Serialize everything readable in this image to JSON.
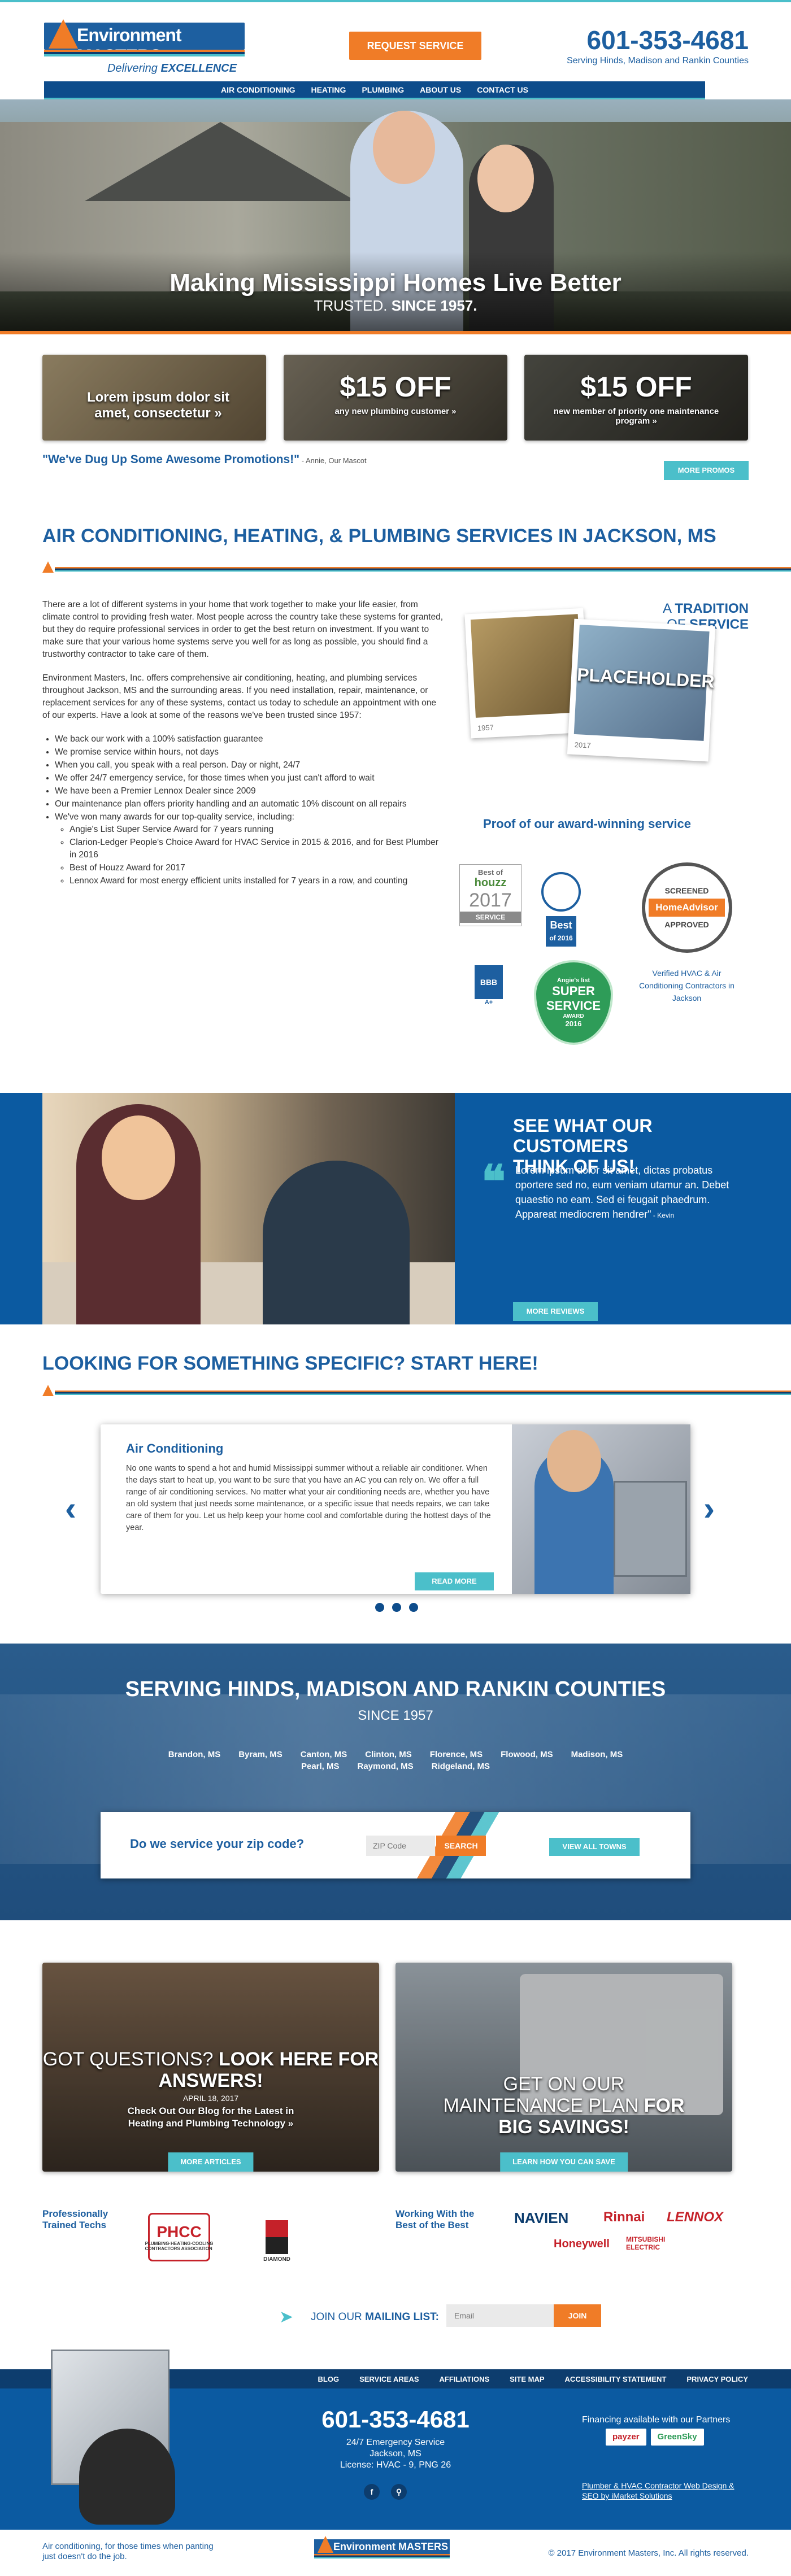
{
  "header": {
    "logo_name": "Environment MASTERS",
    "logo_tag_prefix": "Delivering",
    "logo_tag_bold": "EXCELLENCE",
    "request_button": "REQUEST SERVICE",
    "phone": "601-353-4681",
    "serving": "Serving Hinds, Madison and Rankin Counties"
  },
  "nav": [
    "AIR CONDITIONING",
    "HEATING",
    "PLUMBING",
    "ABOUT US",
    "CONTACT US"
  ],
  "hero": {
    "title": "Making Mississippi Homes Live Better",
    "sub_prefix": "TRUSTED.",
    "sub_bold": "SINCE 1957."
  },
  "promos": {
    "promo1": "Lorem ipsum dolor sit amet, consectetur »",
    "promo2_big": "$15 OFF",
    "promo2_small": "any new plumbing customer »",
    "promo3_big": "$15 OFF",
    "promo3_small": "new member of priority one maintenance program »",
    "quote": "\"We've Dug Up Some Awesome Promotions!\"",
    "quote_by": " - Annie, Our Mascot",
    "more_button": "MORE PROMOS"
  },
  "services": {
    "title_prefix": "AIR CONDITIONING, HEATING, & PLUMBING SERVICES IN",
    "title_bold": "JACKSON, MS",
    "p1": "There are a lot of different systems in your home that work together to make your life easier, from climate control to providing fresh water. Most people across the country take these systems for granted, but they do require professional services in order to get the best return on investment. If you want to make sure that your various home systems serve you well for as long as possible, you should find a trustworthy contractor to take care of them.",
    "p2": "Environment Masters, Inc. offers comprehensive air conditioning, heating, and plumbing services throughout Jackson, MS and the surrounding areas. If you need installation, repair, maintenance, or replacement services for any of these systems, contact us today to schedule an appointment with one of our experts. Have a look at some of the reasons we've been trusted since 1957:",
    "bullets": [
      "We back our work with a 100% satisfaction guarantee",
      "We promise service within hours, not days",
      "When you call, you speak with a real person. Day or night, 24/7",
      "We offer 24/7 emergency service, for those times when you just can't afford to wait",
      "We have been a Premier Lennox Dealer since 2009",
      "Our maintenance plan offers priority handling and an automatic 10% discount on all repairs",
      "We've won many awards for our top-quality service, including:"
    ],
    "sub_bullets": [
      "Angie's List Super Service Award for 7 years running",
      "Clarion-Ledger People's Choice Award for HVAC Service in 2015 & 2016, and for Best Plumber in 2016",
      "Best of Houzz Award for 2017",
      "Lennox Award for most energy efficient units installed for 7 years in a row, and counting"
    ],
    "tradition_prefix": "A",
    "tradition_bold": "TRADITION",
    "tradition_of": "OF",
    "tradition_service": "SERVICE",
    "year_old": "1957",
    "year_new": "2017",
    "placeholder": "PLACEHOLDER",
    "proof": "Proof of our award-winning service",
    "houzz_best_of": "Best of",
    "houzz_name": "houzz",
    "houzz_year": "2017",
    "houzz_service": "SERVICE",
    "clarion_best": "Best",
    "clarion_year": "of 2016",
    "ha_screened": "SCREENED",
    "ha_name": "HomeAdvisor",
    "ha_approved": "APPROVED",
    "ha_sub": "Verified HVAC & Air Conditioning Contractors in Jackson",
    "bbb": "BBB",
    "bbb_rating": "A+",
    "angie_label": "Angie's list",
    "angie_super": "SUPER",
    "angie_service": "SERVICE",
    "angie_award": "AWARD",
    "angie_year": "2016"
  },
  "reviews": {
    "title_prefix": "SEE WHAT OUR CUSTOMERS",
    "title_bold": "THINK OF US!",
    "body": "Lorem ipsum dolor sit amet, dictas probatus oportere sed no, eum veniam utamur an. Debet quaestio no eam. Sed ei feugait phaedrum. Appareat mediocrem hendrer\"",
    "author": " - Kevin",
    "button": "MORE REVIEWS"
  },
  "looking": {
    "title_prefix": "LOOKING FOR SOMETHING SPECIFIC?",
    "title_bold": "START HERE!",
    "card_title": "Air Conditioning",
    "card_body": "No one wants to spend a hot and humid Mississippi summer without a reliable air conditioner. When the days start to heat up, you want to be sure that you have an AC you can rely on. We offer a full range of air conditioning services. No matter what your air conditioning needs are, whether you have an old system that just needs some maintenance, or a specific issue that needs repairs, we can take care of them for you. Let us help keep your home cool and comfortable during the hottest days of the year.",
    "button": "READ MORE",
    "prev": "‹",
    "next": "›"
  },
  "serving": {
    "title_prefix": "SERVING",
    "title_bold": "HINDS, MADISON AND RANKIN COUNTIES",
    "since": "SINCE 1957",
    "towns": [
      "Brandon, MS",
      "Byram, MS",
      "Canton, MS",
      "Clinton, MS",
      "Florence, MS",
      "Flowood, MS",
      "Madison, MS",
      "Pearl, MS",
      "Raymond, MS",
      "Ridgeland, MS"
    ],
    "zip_question": "Do we service your zip code?",
    "zip_placeholder": "ZIP Code",
    "search_button": "SEARCH",
    "all_towns_button": "VIEW ALL TOWNS"
  },
  "blog": {
    "title_a": "GOT QUESTIONS?",
    "title_b": "LOOK HERE FOR ANSWERS!",
    "date": "APRIL 18, 2017",
    "post": "Check Out Our Blog for the Latest in Heating and Plumbing Technology »",
    "button": "MORE ARTICLES"
  },
  "maintenance": {
    "title_a": "GET ON OUR",
    "title_b": "MAINTENANCE PLAN",
    "title_c": "FOR",
    "title_d": "BIG SAVINGS!",
    "button": "LEARN HOW YOU CAN SAVE"
  },
  "partners": {
    "trained": "Professionally Trained Techs",
    "phcc": "PHCC",
    "phcc_sub": "PLUMBING·HEATING·COOLING CONTRACTORS ASSOCIATION",
    "diamond": "DIAMOND",
    "working": "Working With the Best of the Best",
    "brands": [
      "NAVIEN",
      "Rinnai",
      "LENNOX",
      "Honeywell",
      "MITSUBISHI ELECTRIC"
    ]
  },
  "mailing": {
    "label_prefix": "JOIN OUR",
    "label_bold": "MAILING LIST:",
    "placeholder": "Email",
    "button": "JOIN"
  },
  "footer": {
    "links": [
      "BLOG",
      "SERVICE AREAS",
      "AFFILIATIONS",
      "SITE MAP",
      "ACCESSIBILITY STATEMENT",
      "PRIVACY POLICY"
    ],
    "phone": "601-353-4681",
    "line1": "24/7 Emergency Service",
    "line2": "Jackson, MS",
    "line3": "License: HVAC - 9, PNG 26",
    "financing": "Financing available with our Partners",
    "fin1": "payzer",
    "fin2": "GreenSky",
    "design": "Plumber & HVAC Contractor Web Design & SEO by iMarket Solutions",
    "tagline": "Air conditioning, for those times when panting just doesn't do the job.",
    "copyright": "© 2017 Environment Masters, Inc. All rights reserved."
  },
  "colors": {
    "brand_blue": "#1d5fa0",
    "dark_blue": "#0d3d6e",
    "orange": "#f07c27",
    "teal": "#4bbfca"
  }
}
